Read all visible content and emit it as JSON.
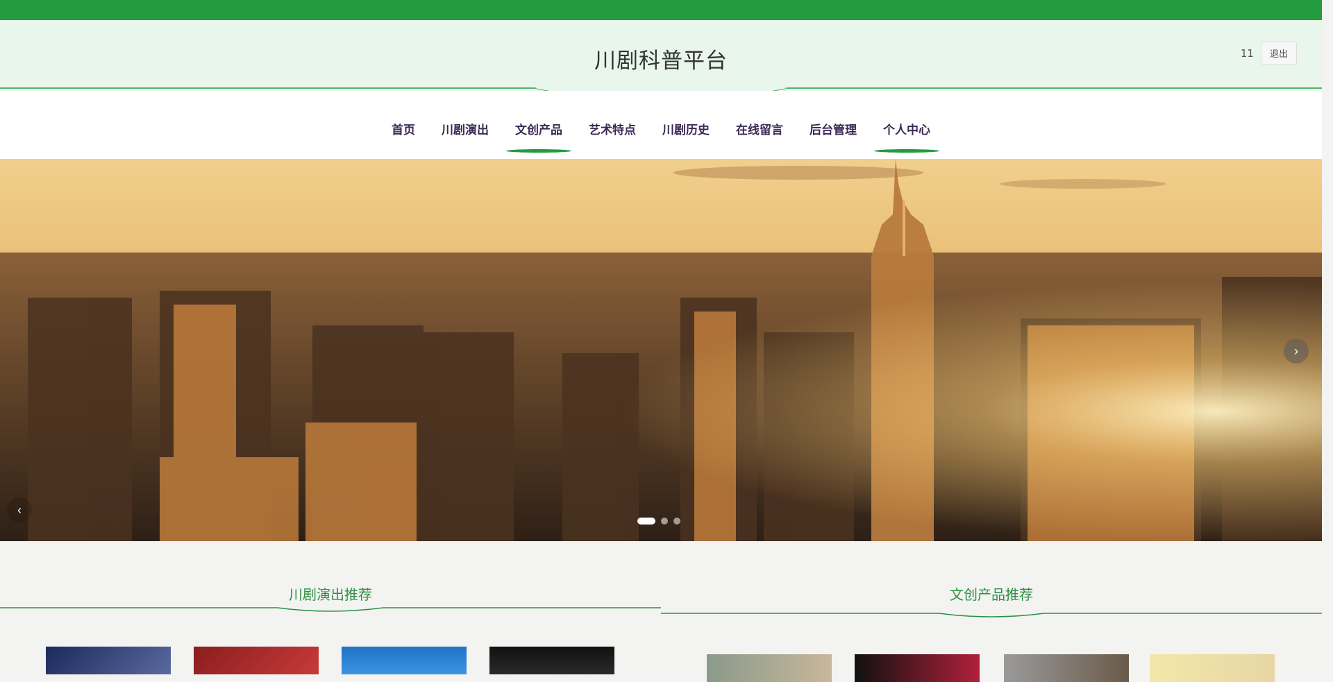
{
  "header": {
    "site_title": "川剧科普平台",
    "user_name": "11",
    "logout_label": "退出"
  },
  "nav": {
    "items": [
      {
        "label": "首页",
        "active": false
      },
      {
        "label": "川剧演出",
        "active": false
      },
      {
        "label": "文创产品",
        "active": true
      },
      {
        "label": "艺术特点",
        "active": false
      },
      {
        "label": "川剧历史",
        "active": false
      },
      {
        "label": "在线留言",
        "active": false
      },
      {
        "label": "后台管理",
        "active": false
      },
      {
        "label": "个人中心",
        "active": true
      }
    ]
  },
  "banner": {
    "prev_icon": "chevron-left-icon",
    "next_icon": "chevron-right-icon",
    "prev_glyph": "‹",
    "next_glyph": "›",
    "slide_count": 3,
    "active_slide": 1
  },
  "sections": {
    "left_title": "川剧演出推荐",
    "right_title": "文创产品推荐"
  },
  "colors": {
    "brand_green": "#259b3f",
    "header_bg": "#e9f6ec",
    "nav_text": "#3b2a55",
    "section_title": "#2f8f45"
  }
}
